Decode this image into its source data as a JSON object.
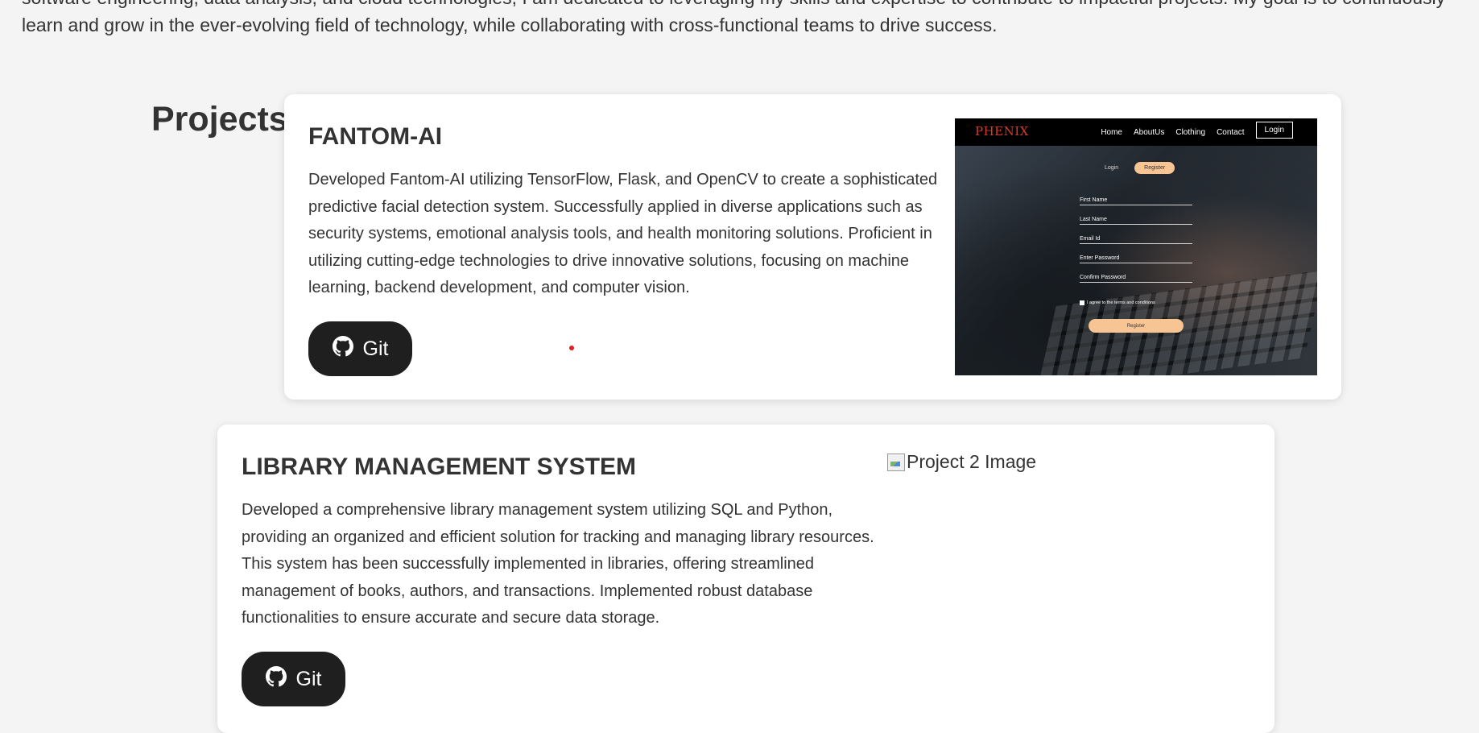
{
  "about": {
    "text": "software engineering, data analysis, and cloud technologies, I am dedicated to leveraging my skills and expertise to contribute to impactful projects. My goal is to continuously learn and grow in the ever-evolving field of technology, while collaborating with cross-functional teams to drive success."
  },
  "projects": {
    "heading": "Projects",
    "items": [
      {
        "title": "FANTOM-AI",
        "description": "Developed Fantom-AI utilizing TensorFlow, Flask, and OpenCV to create a sophisticated predictive facial detection system. Successfully applied in diverse applications such as security systems, emotional analysis tools, and health monitoring solutions. Proficient in utilizing cutting-edge technologies to drive innovative solutions, focusing on machine learning, backend development, and computer vision.",
        "git_label": "Git",
        "git_icon": "github-icon",
        "screenshot": {
          "logo": "PHENIX",
          "nav": [
            "Home",
            "AboutUs",
            "Clothing",
            "Contact"
          ],
          "login": "Login",
          "tab_login": "Login",
          "tab_register": "Register",
          "fields": [
            "First Name",
            "Last Name",
            "Email Id",
            "Enter Password",
            "Confirm Password"
          ],
          "agree": "I agree to the terms and conditions",
          "register_button": "Register"
        }
      },
      {
        "title": "LIBRARY MANAGEMENT SYSTEM",
        "description": "Developed a comprehensive library management system utilizing SQL and Python, providing an organized and efficient solution for tracking and managing library resources. This system has been successfully implemented in libraries, offering streamlined management of books, authors, and transactions. Implemented robust database functionalities to ensure accurate and secure data storage.",
        "git_label": "Git",
        "git_icon": "github-icon",
        "image_alt": "Project 2 Image"
      }
    ]
  },
  "colors": {
    "page_bg": "#f4f4f4",
    "card_bg": "#ffffff",
    "button_bg": "#1f1f1f",
    "text": "#333333",
    "accent_dot": "#e02020"
  }
}
